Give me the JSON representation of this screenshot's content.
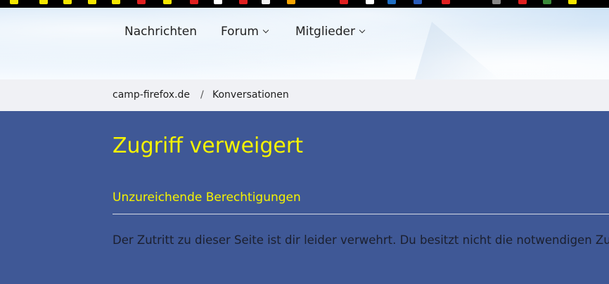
{
  "bookmarks_bar": {
    "icons": [
      {
        "name": "bookmark-yellow-icon",
        "color": "#f3e600"
      },
      {
        "name": "bookmark-yellow-icon",
        "color": "#f3e600"
      },
      {
        "name": "bookmark-yellow-icon",
        "color": "#f3e600"
      },
      {
        "name": "bookmark-yellow-icon",
        "color": "#f3e600"
      },
      {
        "name": "bookmark-yellow-icon",
        "color": "#f3e600"
      },
      {
        "name": "bookmark-red-icon",
        "color": "#e02020"
      },
      {
        "name": "bookmark-yellow-icon",
        "color": "#f3e600"
      },
      {
        "name": "bookmark-red-icon",
        "color": "#e02020"
      },
      {
        "name": "bookmark-white-icon",
        "color": "#ffffff"
      },
      {
        "name": "bookmark-red-icon",
        "color": "#e02020"
      },
      {
        "name": "bookmark-white-icon",
        "color": "#f2f2f2"
      },
      {
        "name": "bookmark-orange-icon",
        "color": "#f7a400"
      },
      {
        "name": "bookmark-red-icon",
        "color": "#e02020"
      },
      {
        "name": "bookmark-white-icon",
        "color": "#ffffff"
      },
      {
        "name": "bookmark-blue-icon",
        "color": "#1f6fc4"
      },
      {
        "name": "bookmark-blue-icon",
        "color": "#2a5cb8"
      },
      {
        "name": "bookmark-red-icon",
        "color": "#e02020"
      },
      {
        "name": "bookmark-gray-icon",
        "color": "#888888"
      },
      {
        "name": "bookmark-red-icon",
        "color": "#e02020"
      },
      {
        "name": "bookmark-green-icon",
        "color": "#3a8a3a"
      },
      {
        "name": "bookmark-yellow-icon",
        "color": "#f3e600"
      }
    ]
  },
  "nav": {
    "items": [
      {
        "label": "Nachrichten",
        "has_dropdown": false
      },
      {
        "label": "Forum",
        "has_dropdown": true
      },
      {
        "label": "Mitglieder",
        "has_dropdown": true
      }
    ]
  },
  "breadcrumb": {
    "items": [
      "camp-firefox.de",
      "Konversationen"
    ],
    "separator": "/"
  },
  "page": {
    "title": "Zugriff verweigert",
    "subtitle": "Unzureichende Berechtigungen",
    "message": "Der Zutritt zu dieser Seite ist dir leider verwehrt. Du besitzt nicht die notwendigen Zu"
  },
  "colors": {
    "content_background": "#3f5896",
    "title_color": "#f6f300",
    "breadcrumb_background": "#f0f1f5"
  }
}
